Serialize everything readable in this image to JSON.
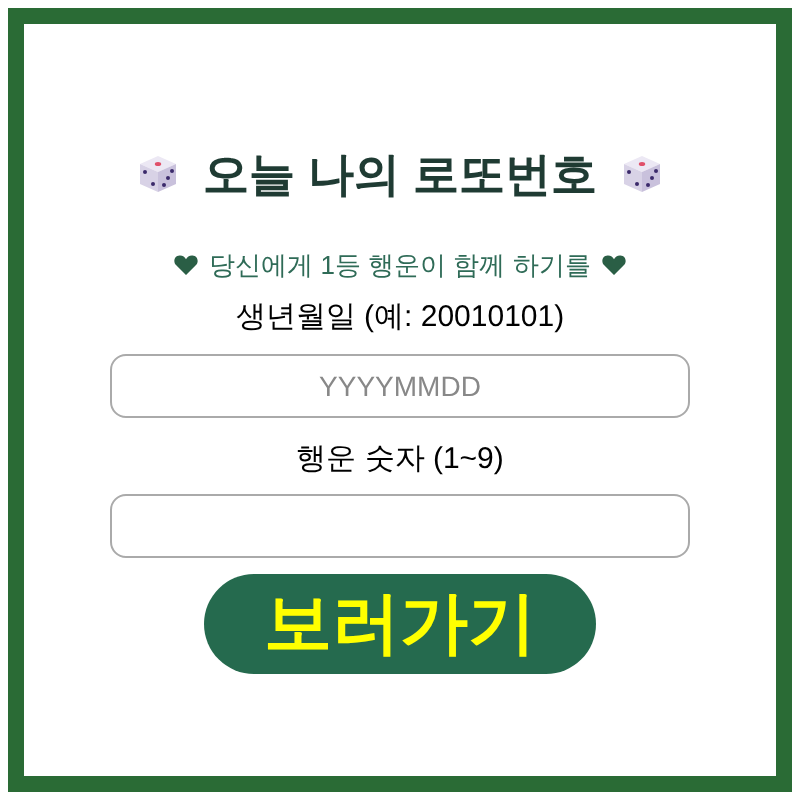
{
  "title": "오늘 나의 로또번호",
  "subtitle": "당신에게 1등 행운이 함께 하기를",
  "fields": [
    {
      "label": "생년월일 (예: 20010101)",
      "placeholder": "YYYYMMDD"
    },
    {
      "label": "행운 숫자 (1~9)"
    }
  ],
  "button": "보러가기"
}
